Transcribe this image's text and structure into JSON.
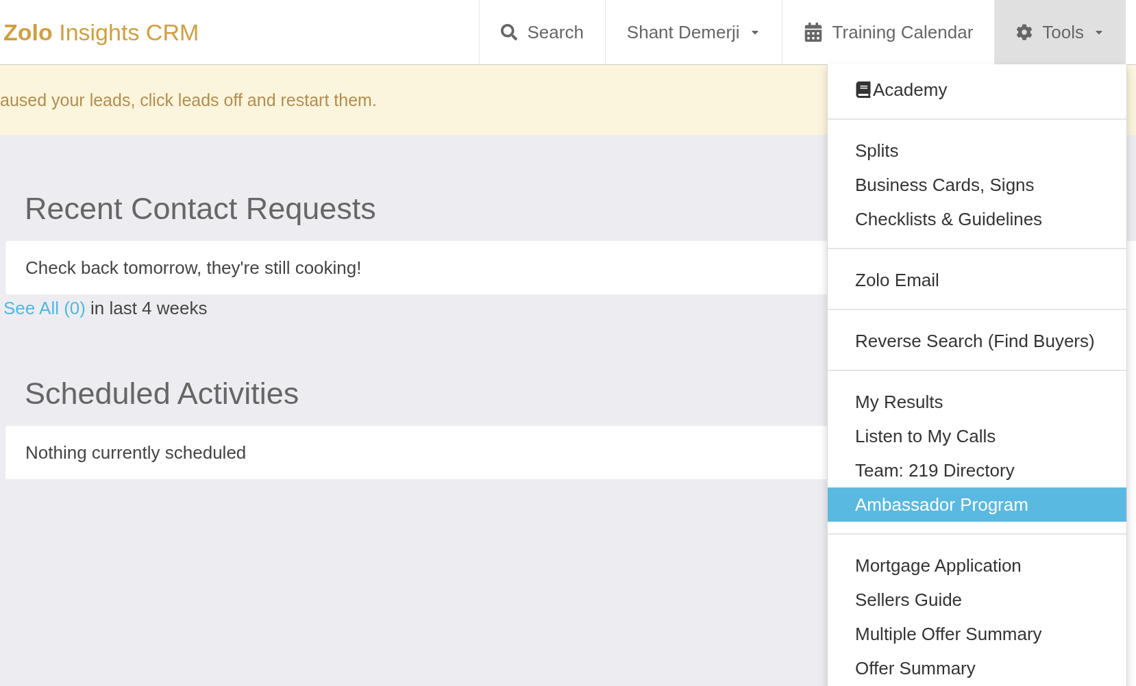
{
  "navbar": {
    "brand": "**Zolo** Insights CRM",
    "items": [
      {
        "kind": "search",
        "label": "Search",
        "expanded": false
      },
      {
        "kind": "user",
        "label": "Shant Demerji",
        "expanded": false
      },
      {
        "kind": "calendar",
        "label": "Training Calendar",
        "expanded": false
      },
      {
        "kind": "tools",
        "label": "Tools",
        "expanded": true
      }
    ]
  },
  "alert": {
    "text": "aused your leads, click leads off and restart them."
  },
  "sections": [
    {
      "title": "Recent Contact Requests",
      "message": "Check back tomorrow, they're still cooking!",
      "link": "See All (0)",
      "note": "in last 4 weeks"
    },
    {
      "title": "Scheduled Activities",
      "message": "Nothing currently scheduled"
    }
  ],
  "tools_menu": {
    "groups": [
      {
        "items": [
          {
            "kind": "icon",
            "label": "Academy",
            "selected": false
          }
        ]
      },
      {
        "items": [
          {
            "kind": "plain",
            "label": "Splits",
            "selected": false
          },
          {
            "kind": "plain",
            "label": "Business Cards, Signs",
            "selected": false
          },
          {
            "kind": "plain",
            "label": "Checklists & Guidelines",
            "selected": false
          }
        ]
      },
      {
        "items": [
          {
            "kind": "plain",
            "label": "Zolo Email",
            "selected": false
          }
        ]
      },
      {
        "items": [
          {
            "kind": "plain",
            "label": "Reverse Search (Find Buyers)",
            "selected": false
          }
        ]
      },
      {
        "items": [
          {
            "kind": "plain",
            "label": "My Results",
            "selected": false
          },
          {
            "kind": "plain",
            "label": "Listen to My Calls",
            "selected": false
          },
          {
            "kind": "plain",
            "label": "Team: 219 Directory",
            "selected": false
          },
          {
            "kind": "plain",
            "label": "Ambassador Program",
            "selected": true
          }
        ]
      },
      {
        "items": [
          {
            "kind": "plain",
            "label": "Mortgage Application",
            "selected": false
          },
          {
            "kind": "plain",
            "label": "Sellers Guide",
            "selected": false
          },
          {
            "kind": "plain",
            "label": "Multiple Offer Summary",
            "selected": false
          },
          {
            "kind": "plain",
            "label": "Offer Summary",
            "selected": false
          }
        ]
      }
    ]
  }
}
